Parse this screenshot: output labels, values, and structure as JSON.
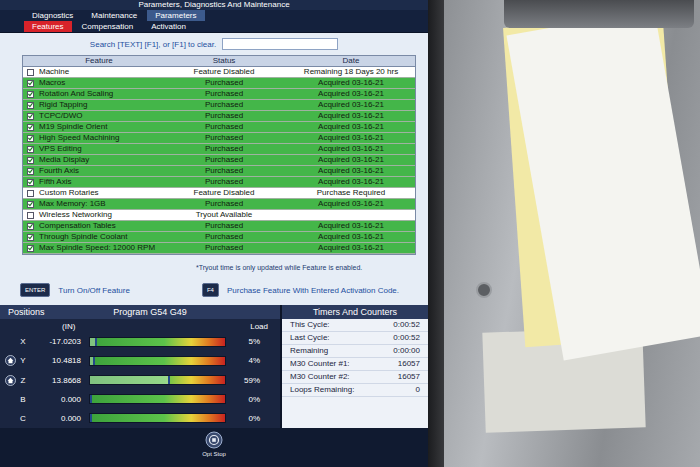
{
  "title_bar": "Parameters, Diagnostics And Maintenance",
  "tabs": [
    {
      "label": "Diagnostics",
      "selected": false
    },
    {
      "label": "Maintenance",
      "selected": false
    },
    {
      "label": "Parameters",
      "selected": true
    }
  ],
  "subtabs": [
    {
      "label": "Features",
      "selected": true
    },
    {
      "label": "Compensation",
      "selected": false
    },
    {
      "label": "Activation",
      "selected": false
    }
  ],
  "search": {
    "label": "Search [TEXT] [F1], or [F1] to clear.",
    "value": ""
  },
  "table": {
    "columns": [
      "Feature",
      "Status",
      "Date"
    ],
    "rows": [
      {
        "feature": "Machine",
        "status": "Feature Disabled",
        "date": "Remaining 18 Days 20 hrs",
        "checked": false,
        "purchased": false
      },
      {
        "feature": "Macros",
        "status": "Purchased",
        "date": "Acquired 03-16-21",
        "checked": true,
        "purchased": true
      },
      {
        "feature": "Rotation And Scaling",
        "status": "Purchased",
        "date": "Acquired 03-16-21",
        "checked": true,
        "purchased": true
      },
      {
        "feature": "Rigid Tapping",
        "status": "Purchased",
        "date": "Acquired 03-16-21",
        "checked": true,
        "purchased": true
      },
      {
        "feature": "TCPC/DWO",
        "status": "Purchased",
        "date": "Acquired 03-16-21",
        "checked": true,
        "purchased": true
      },
      {
        "feature": "M19 Spindle Orient",
        "status": "Purchased",
        "date": "Acquired 03-16-21",
        "checked": true,
        "purchased": true
      },
      {
        "feature": "High Speed Machining",
        "status": "Purchased",
        "date": "Acquired 03-16-21",
        "checked": true,
        "purchased": true
      },
      {
        "feature": "VPS Editing",
        "status": "Purchased",
        "date": "Acquired 03-16-21",
        "checked": true,
        "purchased": true
      },
      {
        "feature": "Media Display",
        "status": "Purchased",
        "date": "Acquired 03-16-21",
        "checked": true,
        "purchased": true
      },
      {
        "feature": "Fourth Axis",
        "status": "Purchased",
        "date": "Acquired 03-16-21",
        "checked": true,
        "purchased": true
      },
      {
        "feature": "Fifth Axis",
        "status": "Purchased",
        "date": "Acquired 03-16-21",
        "checked": true,
        "purchased": true
      },
      {
        "feature": "Custom Rotaries",
        "status": "Feature Disabled",
        "date": "Purchase Required",
        "checked": false,
        "purchased": false
      },
      {
        "feature": "Max Memory: 1GB",
        "status": "Purchased",
        "date": "Acquired 03-16-21",
        "checked": true,
        "purchased": true
      },
      {
        "feature": "Wireless Networking",
        "status": "Tryout Available",
        "date": "",
        "checked": false,
        "purchased": false
      },
      {
        "feature": "Compensation Tables",
        "status": "Purchased",
        "date": "Acquired 03-16-21",
        "checked": true,
        "purchased": true
      },
      {
        "feature": "Through Spindle Coolant",
        "status": "Purchased",
        "date": "Acquired 03-16-21",
        "checked": true,
        "purchased": true
      },
      {
        "feature": "Max Spindle Speed: 12000 RPM",
        "status": "Purchased",
        "date": "Acquired 03-16-21",
        "checked": true,
        "purchased": true
      }
    ]
  },
  "note": "*Tryout time is only updated while Feature is enabled.",
  "keys": [
    {
      "key": "ENTER",
      "label": "Turn On/Off Feature"
    },
    {
      "key": "F4",
      "label": "Purchase Feature With Entered Activation Code."
    }
  ],
  "positions": {
    "title": "Positions",
    "program": "Program G54 G49",
    "units": "(IN)",
    "load_label": "Load",
    "axes": [
      {
        "axis": "X",
        "value": "-17.0203",
        "load": "5%",
        "level": 0.05,
        "homed": false
      },
      {
        "axis": "Y",
        "value": "10.4818",
        "load": "4%",
        "level": 0.04,
        "homed": true
      },
      {
        "axis": "Z",
        "value": "13.8668",
        "load": "59%",
        "level": 0.59,
        "homed": true
      },
      {
        "axis": "B",
        "value": "0.000",
        "load": "0%",
        "level": 0.0,
        "homed": false
      },
      {
        "axis": "C",
        "value": "0.000",
        "load": "0%",
        "level": 0.0,
        "homed": false
      }
    ]
  },
  "timers": {
    "title": "Timers And Counters",
    "rows": [
      {
        "label": "This Cycle:",
        "value": "0:00:52"
      },
      {
        "label": "Last Cycle:",
        "value": "0:00:52"
      },
      {
        "label": "Remaining",
        "value": "0:00:00"
      },
      {
        "label": "M30 Counter #1:",
        "value": "16057"
      },
      {
        "label": "M30 Counter #2:",
        "value": "16057"
      },
      {
        "label": "Loops Remaining:",
        "value": "0"
      }
    ]
  },
  "buttons": [
    {
      "label": "Opt Stop"
    }
  ]
}
